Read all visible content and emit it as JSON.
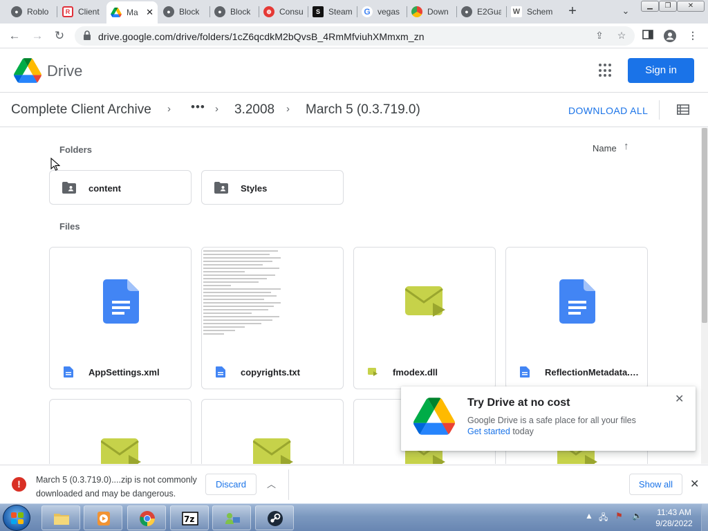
{
  "browser": {
    "tabs": [
      {
        "title": "Roblo",
        "favicon": "globe-icon",
        "active": false
      },
      {
        "title": "Client",
        "favicon": "roblox-icon",
        "active": false
      },
      {
        "title": "Ma",
        "favicon": "drive-icon",
        "active": true
      },
      {
        "title": "Block",
        "favicon": "globe-icon",
        "active": false
      },
      {
        "title": "Block",
        "favicon": "globe-icon",
        "active": false
      },
      {
        "title": "Consu",
        "favicon": "red-globe-icon",
        "active": false
      },
      {
        "title": "Steam",
        "favicon": "steam-icon",
        "active": false
      },
      {
        "title": "vegas",
        "favicon": "google-icon",
        "active": false
      },
      {
        "title": "Down",
        "favicon": "chrome-web-icon",
        "active": false
      },
      {
        "title": "E2Gua",
        "favicon": "globe-icon",
        "active": false
      },
      {
        "title": "Schem",
        "favicon": "wiki-icon",
        "active": false
      }
    ],
    "url": "drive.google.com/drive/folders/1cZ6qcdkM2bQvsB_4RmMfviuhXMmxm_zn"
  },
  "drive": {
    "app_name": "Drive",
    "sign_in": "Sign in",
    "breadcrumb": {
      "root": "Complete Client Archive",
      "ellipsis": "•••",
      "middle": "3.2008",
      "current": "March 5 (0.3.719.0)"
    },
    "download_all": "DOWNLOAD ALL",
    "folders_label": "Folders",
    "files_label": "Files",
    "sort": {
      "label": "Name",
      "direction": "ascending"
    },
    "folders": [
      "content",
      "Styles"
    ],
    "files": [
      {
        "name": "AppSettings.xml",
        "type": "doc"
      },
      {
        "name": "copyrights.txt",
        "type": "doc"
      },
      {
        "name": "fmodex.dll",
        "type": "binary"
      },
      {
        "name": "ReflectionMetadata.x...",
        "type": "doc"
      }
    ],
    "colors": {
      "accent": "#1a73e8",
      "doc": "#4285f4",
      "binary": "#c6d24a"
    }
  },
  "popup": {
    "title": "Try Drive at no cost",
    "body": "Google Drive is a safe place for all your files",
    "link": "Get started",
    "suffix": " today"
  },
  "download_bar": {
    "line1": "March 5 (0.3.719.0)....zip is not commonly",
    "line2": "downloaded and may be dangerous.",
    "discard": "Discard",
    "show_all": "Show all"
  },
  "taskbar": {
    "apps": [
      "explorer-icon",
      "media-player-icon",
      "chrome-icon",
      "7zip-icon",
      "network-icon",
      "steam-icon"
    ],
    "time": "11:43 AM",
    "date": "9/28/2022"
  }
}
